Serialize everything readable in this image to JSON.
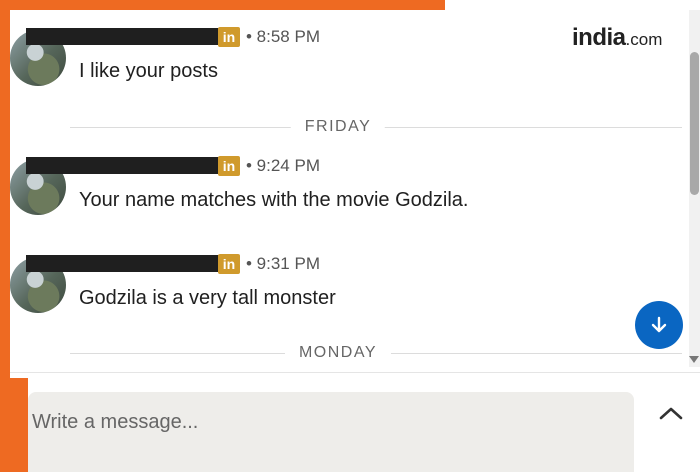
{
  "brand": {
    "name": "india",
    "suffix": ".com"
  },
  "messages": [
    {
      "badge": "in",
      "time": "• 8:58 PM",
      "text": "I like your posts"
    },
    {
      "badge": "in",
      "time": "• 9:24 PM",
      "text": "Your name matches with the movie Godzila."
    },
    {
      "badge": "in",
      "time": "• 9:31 PM",
      "text": "Godzila is a very tall monster"
    }
  ],
  "dividers": [
    "FRIDAY",
    "MONDAY"
  ],
  "composer": {
    "placeholder": "Write a message..."
  },
  "icons": {
    "linkedin_badge": "linkedin-icon",
    "scroll_down": "arrow-down-icon",
    "expand": "chevron-up-icon"
  },
  "colors": {
    "accent_orange": "#ee6a22",
    "linkedin_blue": "#0a66c2",
    "badge_gold": "#d09a2c"
  }
}
